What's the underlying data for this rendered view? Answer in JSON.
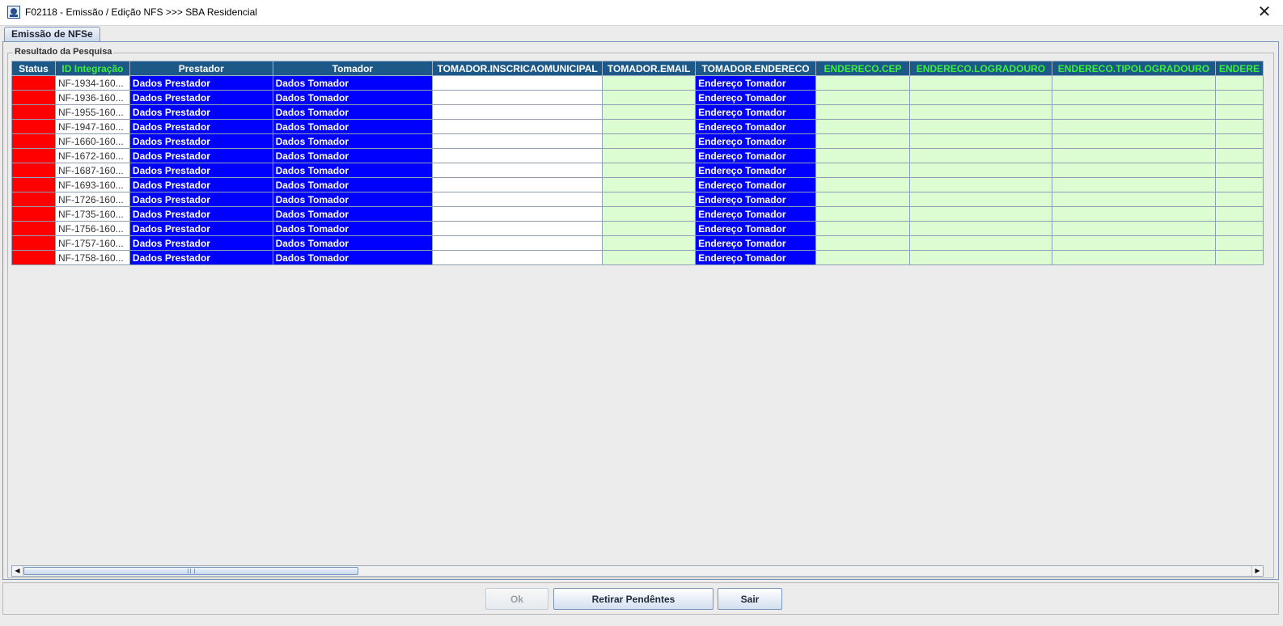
{
  "window": {
    "title": "F02118 - Emissão / Edição NFS >>> SBA Residencial",
    "close_glyph": "✕"
  },
  "tabs": [
    {
      "label": "Emissão de NFSe",
      "active": true
    }
  ],
  "group": {
    "label": "Resultado da Pesquisa"
  },
  "table": {
    "columns": [
      {
        "label": "Status",
        "highlight": false
      },
      {
        "label": "ID Integração",
        "highlight": true
      },
      {
        "label": "Prestador",
        "highlight": false
      },
      {
        "label": "Tomador",
        "highlight": false
      },
      {
        "label": "TOMADOR.INSCRICAOMUNICIPAL",
        "highlight": false
      },
      {
        "label": "TOMADOR.EMAIL",
        "highlight": false
      },
      {
        "label": "TOMADOR.ENDERECO",
        "highlight": false
      },
      {
        "label": "ENDERECO.CEP",
        "highlight": true
      },
      {
        "label": "ENDERECO.LOGRADOURO",
        "highlight": true
      },
      {
        "label": "ENDERECO.TIPOLOGRADOURO",
        "highlight": true
      },
      {
        "label": "ENDERE",
        "highlight": true
      }
    ],
    "rows": [
      {
        "id": "NF-1934-160...",
        "prestador": "Dados Prestador",
        "tomador": "Dados Tomador",
        "inscricao": "",
        "email": "",
        "endereco": "Endereço Tomador",
        "cep": "",
        "logradouro": "",
        "tipologradouro": "",
        "extra": ""
      },
      {
        "id": "NF-1936-160...",
        "prestador": "Dados Prestador",
        "tomador": "Dados Tomador",
        "inscricao": "",
        "email": "",
        "endereco": "Endereço Tomador",
        "cep": "",
        "logradouro": "",
        "tipologradouro": "",
        "extra": ""
      },
      {
        "id": "NF-1955-160...",
        "prestador": "Dados Prestador",
        "tomador": "Dados Tomador",
        "inscricao": "",
        "email": "",
        "endereco": "Endereço Tomador",
        "cep": "",
        "logradouro": "",
        "tipologradouro": "",
        "extra": ""
      },
      {
        "id": "NF-1947-160...",
        "prestador": "Dados Prestador",
        "tomador": "Dados Tomador",
        "inscricao": "",
        "email": "",
        "endereco": "Endereço Tomador",
        "cep": "",
        "logradouro": "",
        "tipologradouro": "",
        "extra": ""
      },
      {
        "id": "NF-1660-160...",
        "prestador": "Dados Prestador",
        "tomador": "Dados Tomador",
        "inscricao": "",
        "email": "",
        "endereco": "Endereço Tomador",
        "cep": "",
        "logradouro": "",
        "tipologradouro": "",
        "extra": ""
      },
      {
        "id": "NF-1672-160...",
        "prestador": "Dados Prestador",
        "tomador": "Dados Tomador",
        "inscricao": "",
        "email": "",
        "endereco": "Endereço Tomador",
        "cep": "",
        "logradouro": "",
        "tipologradouro": "",
        "extra": ""
      },
      {
        "id": "NF-1687-160...",
        "prestador": "Dados Prestador",
        "tomador": "Dados Tomador",
        "inscricao": "",
        "email": "",
        "endereco": "Endereço Tomador",
        "cep": "",
        "logradouro": "",
        "tipologradouro": "",
        "extra": ""
      },
      {
        "id": "NF-1693-160...",
        "prestador": "Dados Prestador",
        "tomador": "Dados Tomador",
        "inscricao": "",
        "email": "",
        "endereco": "Endereço Tomador",
        "cep": "",
        "logradouro": "",
        "tipologradouro": "",
        "extra": ""
      },
      {
        "id": "NF-1726-160...",
        "prestador": "Dados Prestador",
        "tomador": "Dados Tomador",
        "inscricao": "",
        "email": "",
        "endereco": "Endereço Tomador",
        "cep": "",
        "logradouro": "",
        "tipologradouro": "",
        "extra": ""
      },
      {
        "id": "NF-1735-160...",
        "prestador": "Dados Prestador",
        "tomador": "Dados Tomador",
        "inscricao": "",
        "email": "",
        "endereco": "Endereço Tomador",
        "cep": "",
        "logradouro": "",
        "tipologradouro": "",
        "extra": ""
      },
      {
        "id": "NF-1756-160...",
        "prestador": "Dados Prestador",
        "tomador": "Dados Tomador",
        "inscricao": "",
        "email": "",
        "endereco": "Endereço Tomador",
        "cep": "",
        "logradouro": "",
        "tipologradouro": "",
        "extra": ""
      },
      {
        "id": "NF-1757-160...",
        "prestador": "Dados Prestador",
        "tomador": "Dados Tomador",
        "inscricao": "",
        "email": "",
        "endereco": "Endereço Tomador",
        "cep": "",
        "logradouro": "",
        "tipologradouro": "",
        "extra": ""
      },
      {
        "id": "NF-1758-160...",
        "prestador": "Dados Prestador",
        "tomador": "Dados Tomador",
        "inscricao": "",
        "email": "",
        "endereco": "Endereço Tomador",
        "cep": "",
        "logradouro": "",
        "tipologradouro": "",
        "extra": ""
      }
    ]
  },
  "scrollbar": {
    "left_glyph": "◀",
    "right_glyph": "▶",
    "position": 0
  },
  "buttons": {
    "ok": {
      "label": "Ok",
      "enabled": false
    },
    "retirar": {
      "label": "Retirar Pendêntes",
      "enabled": true
    },
    "sair": {
      "label": "Sair",
      "enabled": true
    }
  },
  "colors": {
    "status_error": "#ff0000",
    "data_blue": "#0000ff",
    "header_bg": "#1d5988",
    "header_highlight_text": "#3bf03b",
    "empty_green": "#dcfcd2"
  },
  "icons": {
    "app": "app-logo-icon",
    "close": "close-icon"
  }
}
